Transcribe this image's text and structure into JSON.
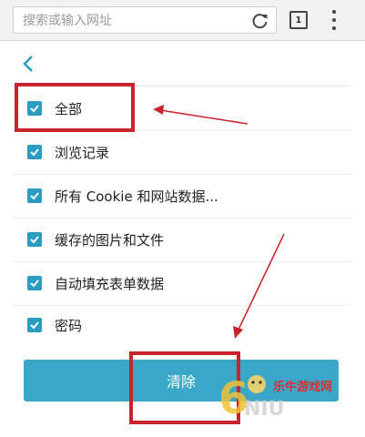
{
  "browser": {
    "url_placeholder": "搜索或输入网址",
    "tab_count": "1",
    "icons": [
      "reload-icon",
      "tabs-icon",
      "overflow-menu-icon"
    ]
  },
  "nav": {
    "back_icon": "chevron-left-icon"
  },
  "options": [
    {
      "label": "全部",
      "checked": true
    },
    {
      "label": "浏览记录",
      "checked": true
    },
    {
      "label": "所有 Cookie 和网站数据...",
      "checked": true
    },
    {
      "label": "缓存的图片和文件",
      "checked": true
    },
    {
      "label": "自动填充表单数据",
      "checked": true
    },
    {
      "label": "密码",
      "checked": true
    }
  ],
  "actions": {
    "clear_label": "清除"
  },
  "watermark": {
    "text": "乐牛游戏网",
    "logo_text": "6NIU.com"
  },
  "colors": {
    "accent": "#3aa6c8",
    "checkbox": "#2a9cc2",
    "annotation": "#c9232b"
  }
}
